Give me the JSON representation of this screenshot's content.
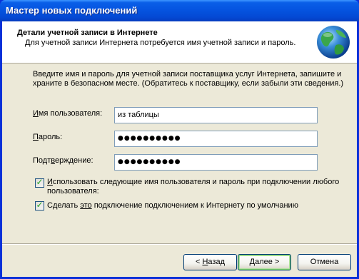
{
  "window": {
    "title": "Мастер новых подключений"
  },
  "header": {
    "title": "Детали учетной записи в Интернете",
    "subtitle": "Для учетной записи Интернета потребуется имя учетной записи и пароль.",
    "icon": "globe-icon"
  },
  "body": {
    "description": "Введите имя и пароль для учетной записи поставщика услуг Интернета, запишите и храните в безопасном месте. (Обратитесь к поставщику, если забыли эти сведения.)"
  },
  "form": {
    "username": {
      "label_key": "И",
      "label_rest": "мя пользователя:",
      "value": "из таблицы"
    },
    "password": {
      "label_key": "П",
      "label_rest": "ароль:",
      "value": "●●●●●●●●●●"
    },
    "confirm": {
      "label_key": "Подт",
      "label_mid": "в",
      "label_rest": "ерждение:",
      "value": "●●●●●●●●●●"
    }
  },
  "options": {
    "use_for_all": {
      "label_key": "И",
      "label_rest": "спользовать следующие имя пользователя и пароль при подключении любого пользователя:",
      "checked": true,
      "disabled": true
    },
    "make_default": {
      "label_pre": "Сделать ",
      "label_key": "это",
      "label_rest": " подключение подключением к Интернету по умолчанию",
      "checked": true
    }
  },
  "buttons": {
    "back": {
      "pre": "< ",
      "key": "Н",
      "rest": "азад"
    },
    "next": {
      "key": "Д",
      "rest": "алее >"
    },
    "cancel": "Отмена"
  },
  "colors": {
    "titlebar": "#0554e0",
    "client_bg": "#ece9d8",
    "checkmark": "#21a121"
  }
}
